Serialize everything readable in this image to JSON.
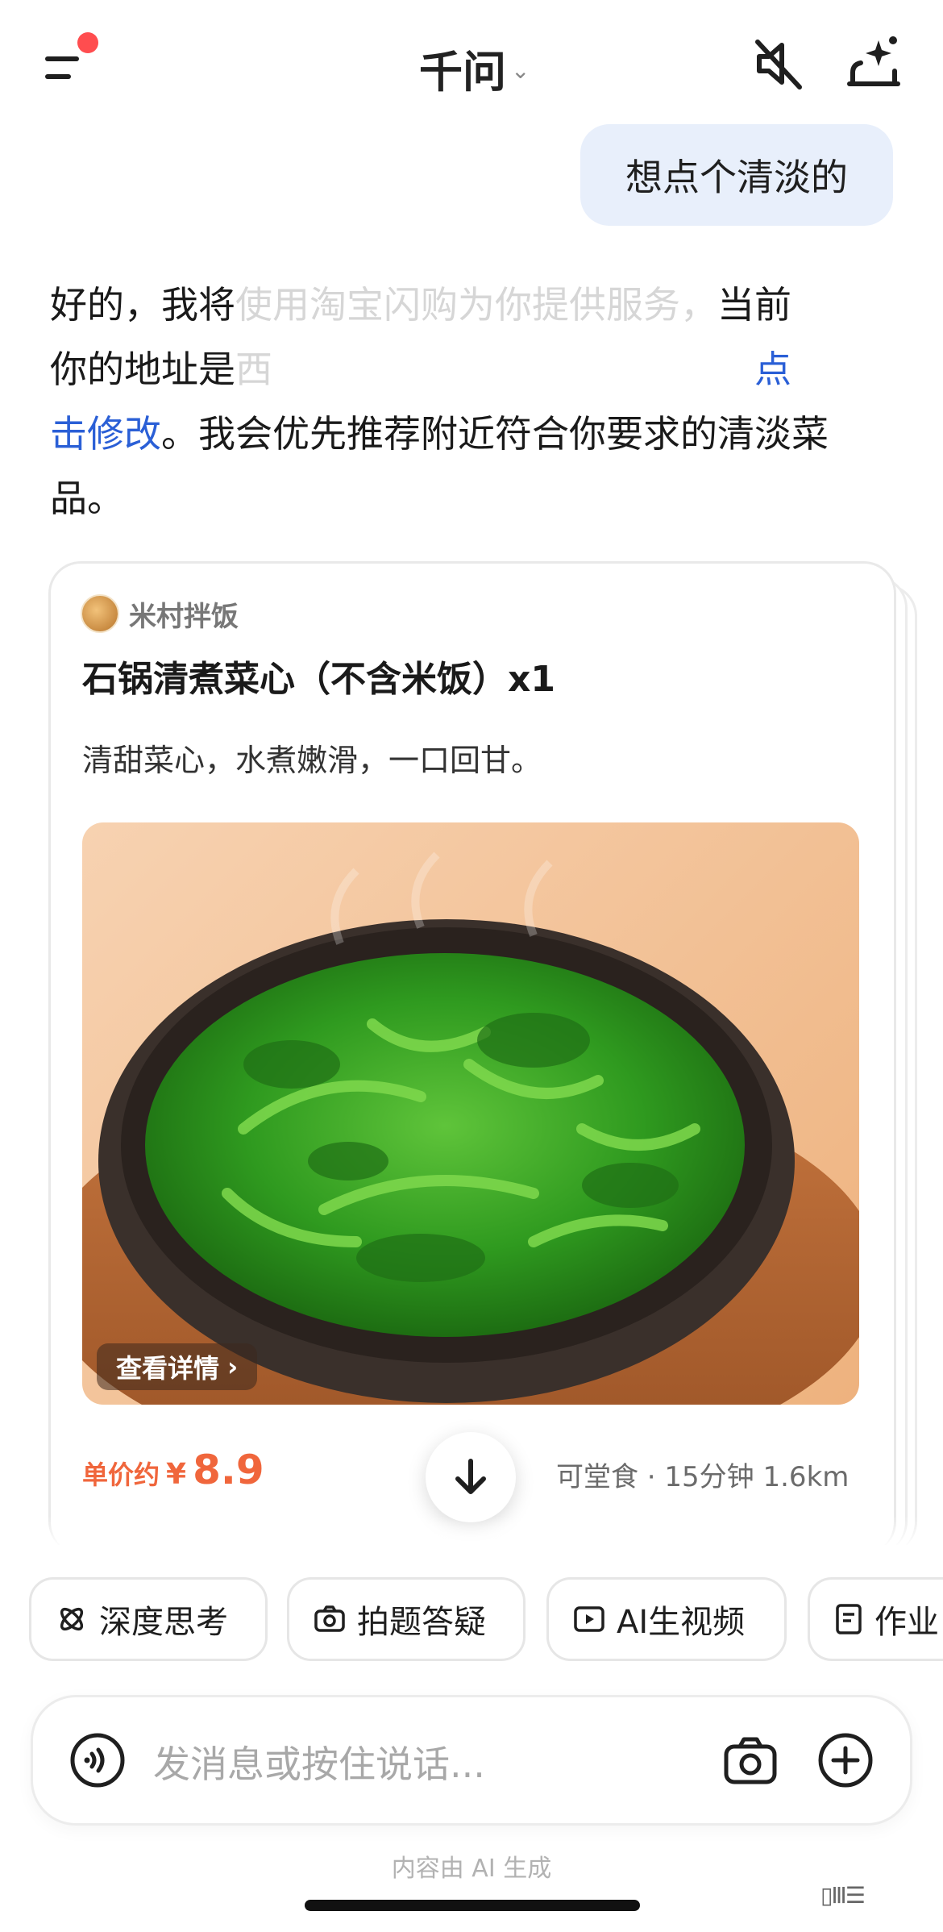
{
  "header": {
    "title": "千问",
    "icons": [
      "menu-icon",
      "notification-dot",
      "chevron-down-icon",
      "mute-icon",
      "ai-assistant-icon"
    ]
  },
  "chat": {
    "user_message": "想点个清淡的",
    "reply": {
      "line1_start": "好的，我将",
      "line1_faded": "使用淘宝闪购为你提供服务，",
      "line1_end": "当前",
      "line2_start": "你的地址是",
      "line2_faded": "西",
      "link_text_1": "点",
      "link_text_2": "击修改",
      "rest": "。我会优先推荐附近符合你要求的清淡菜品。"
    }
  },
  "card": {
    "shop_name": "米村拌饭",
    "dish_title": "石锅清煮菜心（不含米饭）x1",
    "dish_desc": "清甜菜心，水煮嫩滑，一口回甘。",
    "detail_label": "查看详情",
    "price_label": "单价约",
    "price_currency": "¥",
    "price_value": "8.9",
    "meta": "可堂食 · 15分钟 1.6km"
  },
  "chips": {
    "deep_think": "深度思考",
    "photo_qa": "拍题答疑",
    "ai_video": "AI生视频",
    "homework": "作业"
  },
  "input": {
    "placeholder": "发消息或按住说话..."
  },
  "footer": {
    "note": "内容由 AI 生成"
  },
  "colors": {
    "accent_link": "#2a5fd6",
    "price": "#f0663c",
    "user_bubble": "#e8effb",
    "notification": "#ff4d4f"
  }
}
